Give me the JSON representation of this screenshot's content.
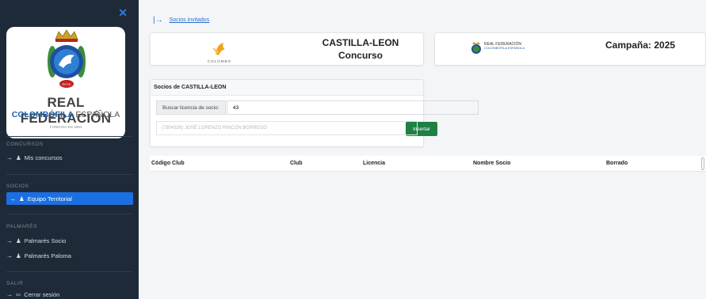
{
  "sidebar": {
    "logo": {
      "line1": "REAL FEDERACIÓN",
      "line2_bold": "COLOMBÓFILA",
      "line2_light": "ESPAÑOLA",
      "line3": "FUNDADA EN 1894"
    },
    "sections": [
      {
        "title": "CONCURSOS",
        "items": [
          {
            "label": "Mis concursos",
            "active": false
          }
        ]
      },
      {
        "title": "SOCIOS",
        "items": [
          {
            "label": "Equipo Territorial",
            "active": true
          }
        ]
      },
      {
        "title": "PALMARÉS",
        "items": [
          {
            "label": "Palmarés Socio",
            "active": false
          },
          {
            "label": "Palmarés Paloma",
            "active": false
          }
        ]
      },
      {
        "title": "SALIR",
        "items": [
          {
            "label": "Cerrar sesión",
            "active": false
          }
        ]
      }
    ]
  },
  "breadcrumb": {
    "link": "Socios invitados"
  },
  "org_card": {
    "logo_text": "COLOMBO",
    "title_line1": "CASTILLA-LEON",
    "title_line2": "Concurso"
  },
  "campaign_card": {
    "logo_line1": "REAL FEDERACIÓN",
    "logo_line2": "COLOMBÓFILA ESPAÑOLA",
    "title": "Campaña: 2025"
  },
  "socios_card": {
    "title": "Socios de CASTILLA-LEON",
    "license_label": "Buscar licencia de socio:",
    "license_value": "43",
    "insert_button": "Insertar",
    "result": "(7804326) JOSÉ LORENZO RINCÓN BORREGO"
  },
  "table": {
    "columns": [
      "Código Club",
      "Club",
      "Licencia",
      "Nombre Socio",
      "Borrado"
    ]
  },
  "colors": {
    "sidebar_bg": "#1f2a38",
    "accent": "#1b6fe0",
    "insert_button": "#1e8043"
  }
}
